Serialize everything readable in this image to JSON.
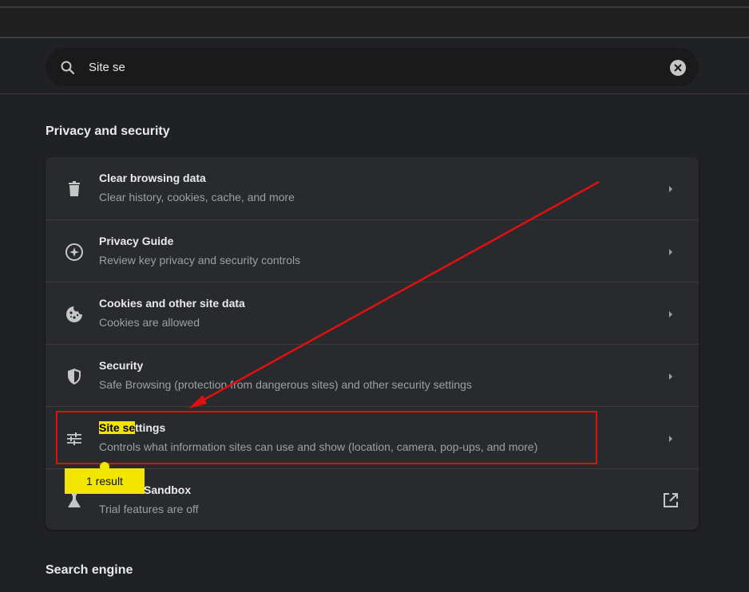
{
  "search": {
    "value": "Site se",
    "icon": "search-icon",
    "clear_icon": "close-icon"
  },
  "section": {
    "title": "Privacy and security"
  },
  "rows": [
    {
      "title": "Clear browsing data",
      "subtitle": "Clear history, cookies, cache, and more",
      "icon": "trash-icon"
    },
    {
      "title": "Privacy Guide",
      "subtitle": "Review key privacy and security controls",
      "icon": "compass-icon"
    },
    {
      "title": "Cookies and other site data",
      "subtitle": "Cookies are allowed",
      "icon": "cookie-icon"
    },
    {
      "title": "Security",
      "subtitle": "Safe Browsing (protection from dangerous sites) and other security settings",
      "icon": "shield-icon"
    },
    {
      "title_highlight": "Site se",
      "title_rest": "ttings",
      "subtitle": "Controls what information sites can use and show (location, camera, pop-ups, and more)",
      "icon": "sliders-icon"
    },
    {
      "title_visible": "Sandbox",
      "subtitle": "Trial features are off",
      "icon": "flask-icon"
    }
  ],
  "tooltip": {
    "label": "1 result"
  },
  "next_section": {
    "title": "Search engine"
  },
  "colors": {
    "background": "#202124",
    "card": "#292a2d",
    "highlight": "#f2e600",
    "annotation": "#e01010"
  }
}
